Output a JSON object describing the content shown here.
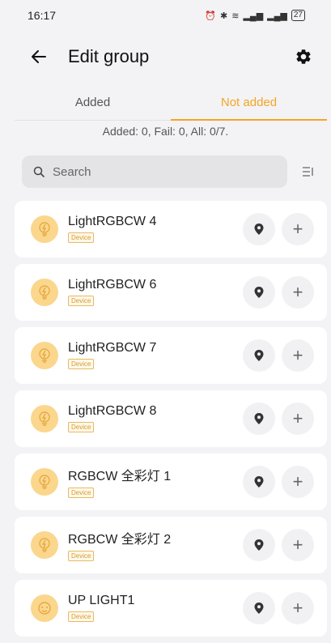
{
  "status": {
    "time": "16:17",
    "battery": "27"
  },
  "header": {
    "title": "Edit group"
  },
  "tabs": [
    {
      "label": "Added",
      "active": false
    },
    {
      "label": "Not added",
      "active": true
    }
  ],
  "summary": "Added: 0, Fail: 0, All: 0/7.",
  "search": {
    "placeholder": "Search"
  },
  "devices": [
    {
      "name": "LightRGBCW 4",
      "badge": "Device",
      "icon": "bulb-icon"
    },
    {
      "name": "LightRGBCW 6",
      "badge": "Device",
      "icon": "bulb-icon"
    },
    {
      "name": "LightRGBCW 7",
      "badge": "Device",
      "icon": "bulb-icon"
    },
    {
      "name": "LightRGBCW 8",
      "badge": "Device",
      "icon": "bulb-icon"
    },
    {
      "name": "RGBCW 全彩灯 1",
      "badge": "Device",
      "icon": "bulb-icon"
    },
    {
      "name": "RGBCW 全彩灯 2",
      "badge": "Device",
      "icon": "bulb-icon"
    },
    {
      "name": "UP LIGHT1",
      "badge": "Device",
      "icon": "ceiling-light-icon"
    }
  ],
  "colors": {
    "accent": "#f4a523",
    "bulb": "#fbd68d",
    "background": "#f3f3f5"
  }
}
